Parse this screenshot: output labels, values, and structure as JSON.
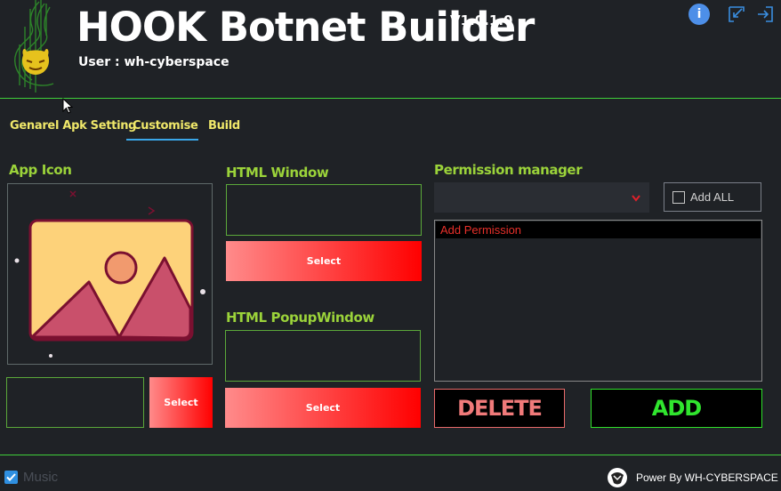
{
  "header": {
    "title": "HOOK Botnet Builder",
    "version": "V1.0.1.0",
    "user_line": "User : wh-cyberspace",
    "info_label": "i",
    "info_icon": "info-icon",
    "minimize_icon": "minimize-window-icon",
    "exit_icon": "exit-icon"
  },
  "tabs": [
    {
      "label": "Genarel Apk Setting",
      "active": false
    },
    {
      "label": "Customise",
      "active": true
    },
    {
      "label": "Build",
      "active": false
    }
  ],
  "app_icon": {
    "heading": "App Icon",
    "path_value": "",
    "select_label": "Select"
  },
  "html_window": {
    "heading": "HTML Window",
    "path_value": "",
    "select_label": "Select"
  },
  "html_popup": {
    "heading": "HTML PopupWindow",
    "path_value": "",
    "select_label": "Select"
  },
  "permission": {
    "heading": "Permission manager",
    "dropdown_value": "",
    "add_all_label": "Add ALL",
    "add_all_checked": false,
    "items": [
      "Add Permission"
    ],
    "delete_label": "DELETE",
    "add_label": "ADD"
  },
  "footer": {
    "music_label": "Music",
    "music_checked": true,
    "power_text": "Power By WH-CYBERSPACE"
  },
  "colors": {
    "background": "#1f2226",
    "accent_green": "#3fcf3a",
    "heading_green": "#9bd33a",
    "tab_yellow": "#f0e86a",
    "tab_underline": "#3aa7e8",
    "select_gradient_start": "#ff8b8b",
    "select_gradient_end": "#ff0000"
  }
}
